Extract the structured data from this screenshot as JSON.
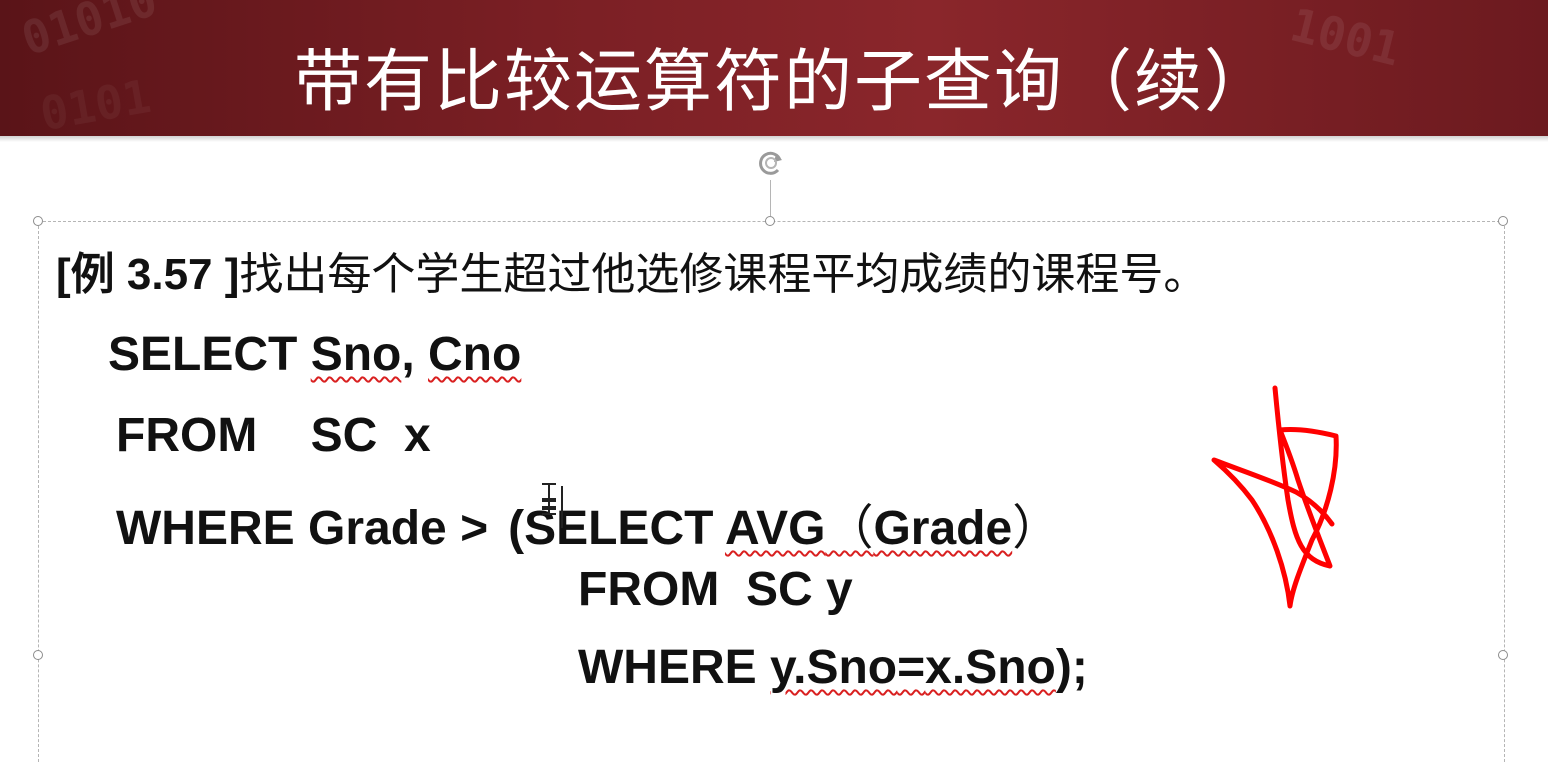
{
  "slide": {
    "title": "带有比较运算符的子查询（续）",
    "title_bg_digits": [
      "01010",
      "1001",
      "0101"
    ],
    "example_tag": "[例 3.57 ]",
    "example_text": "找出每个学生超过他选修课程平均成绩的课程号。",
    "code": {
      "line1_kw": "SELECT ",
      "line1_a": "Sno",
      "line1_sep": ", ",
      "line1_b": "Cno",
      "line2": "FROM    SC  x",
      "line3_pre": "WHERE Grade >",
      "line3_sub_kw": "(SELECT ",
      "line3_func": "AVG",
      "line3_paren_open": "（",
      "line3_arg": "Grade",
      "line3_paren_close": "）",
      "line4": "FROM  SC y",
      "line5_kw": "WHERE ",
      "line5_a": "y.Sno",
      "line5_eq": "=",
      "line5_b": "x.Sno",
      "line5_end": ");"
    }
  },
  "colors": {
    "title_bar": "#7a1f24",
    "annotation": "#ff0000",
    "spellcheck": "#d92020"
  },
  "icons": {
    "rotate_handle": "rotate-icon",
    "cursor": "text-cursor-icon",
    "annotation": "star-annotation-icon"
  }
}
